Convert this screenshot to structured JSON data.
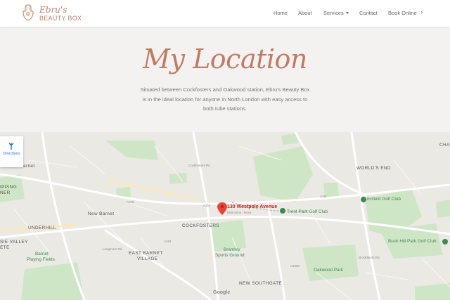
{
  "brand": {
    "name_script": "Ebru's",
    "name_caps": "BEAUTY BOX",
    "logo_icon": "hamsa-hand-icon"
  },
  "nav": {
    "items": [
      "Home",
      "About",
      "Services",
      "Contact",
      "Book Online"
    ],
    "more_icon": "chevron-right-icon"
  },
  "hero": {
    "title": "My Location",
    "description_lines": [
      "Situated between Cockfosters and Oakwood station, Ebru's Beauty Box",
      "is in the ideal location for anyone in North London with easy access to",
      "both tube stations."
    ]
  },
  "map": {
    "directions_label": "Directions",
    "pin_title": "130 Westpole Avenue",
    "pin_subtitle": "Directions · Nove",
    "attribution": "Google",
    "labels": {
      "barnet": "arnet",
      "new_barnet": "New Barnet",
      "underhill": "UNDERHILL",
      "valley": "SIE VALLEY",
      "valley2": "ETE",
      "shipping": "IPPING",
      "shipping2": "NER",
      "barnet_fields_1": "Barnet",
      "barnet_fields_2": "Playing Fields",
      "cockfosters": "COCKFOSTERS",
      "east_barnet_1": "EAST BARNET",
      "east_barnet_2": "VILLAGE",
      "bramley_1": "Bramley",
      "bramley_2": "Sports Ground",
      "new_southgate": "NEW SOUTHGATE",
      "worlds_end": "WORLD'S END",
      "trent_park": "Trent Park Golf Club",
      "enfield_golf": "Enfield Golf Club",
      "bush_hill": "Bush Hill Park Golf Club",
      "oakwood_park": "Oakwood Park",
      "cha": "CHA",
      "road_a111": "A111",
      "road_a110": "A110",
      "road_a110b": "A110",
      "road_a109": "A109",
      "road_cockfosters_rd": "Cockfosters Rd",
      "road_longmore": "Longmore Rd",
      "road_a1000": "A1000",
      "road_b": "Brooklands Rd"
    }
  }
}
